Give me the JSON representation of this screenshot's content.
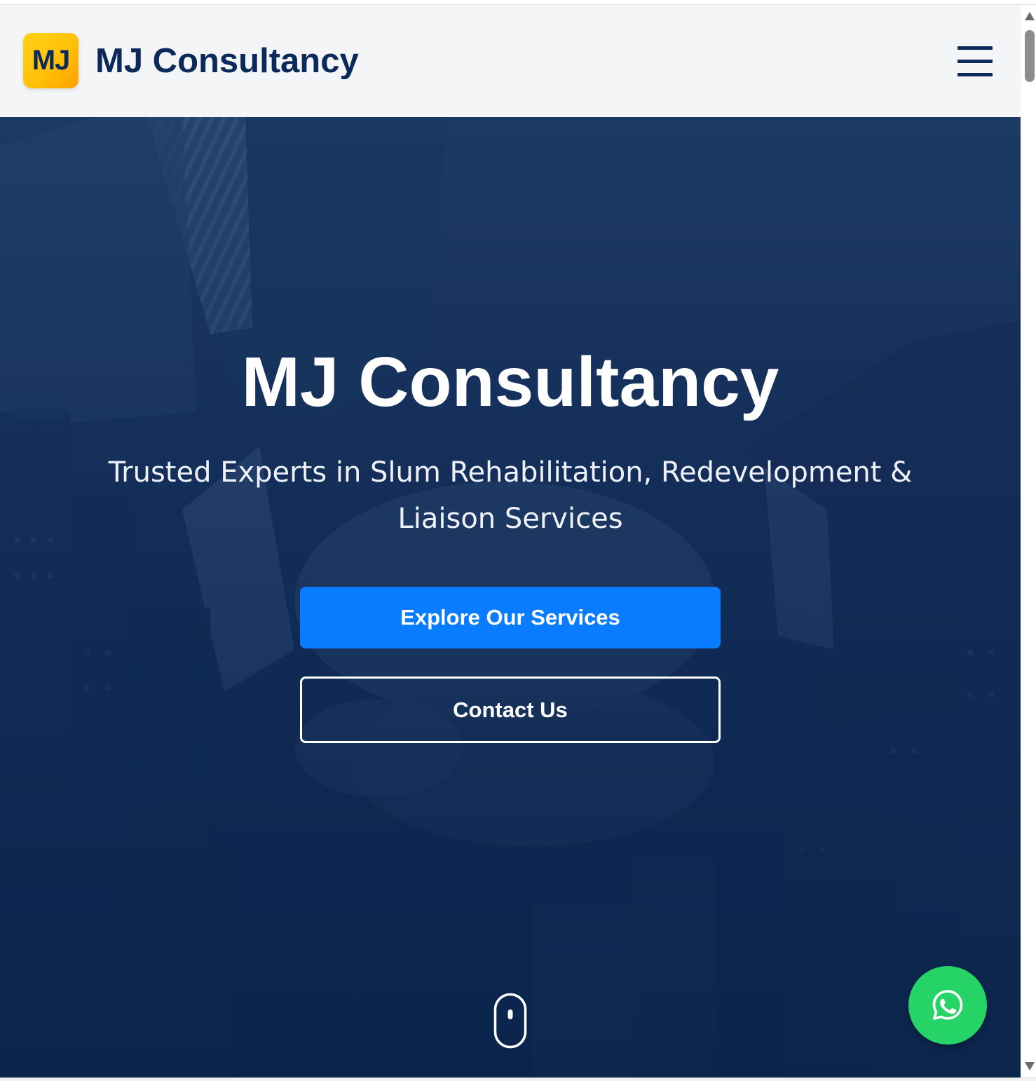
{
  "header": {
    "logo_text": "MJ",
    "brand_name": "MJ Consultancy",
    "menu_icon": "hamburger-menu-icon"
  },
  "hero": {
    "title": "MJ Consultancy",
    "subtitle": "Trusted Experts in Slum Rehabilitation, Redevelopment & Liaison Services",
    "primary_button": "Explore Our Services",
    "secondary_button": "Contact Us",
    "scroll_indicator_icon": "mouse-scroll-icon",
    "background_image": "handshake-city-skyline"
  },
  "floating": {
    "whatsapp_icon": "whatsapp-icon"
  },
  "colors": {
    "brand_navy": "#0b2a5b",
    "logo_yellow": "#ffc107",
    "primary_blue": "#0a7cff",
    "whatsapp_green": "#25d366",
    "hero_overlay": "#112c58"
  }
}
